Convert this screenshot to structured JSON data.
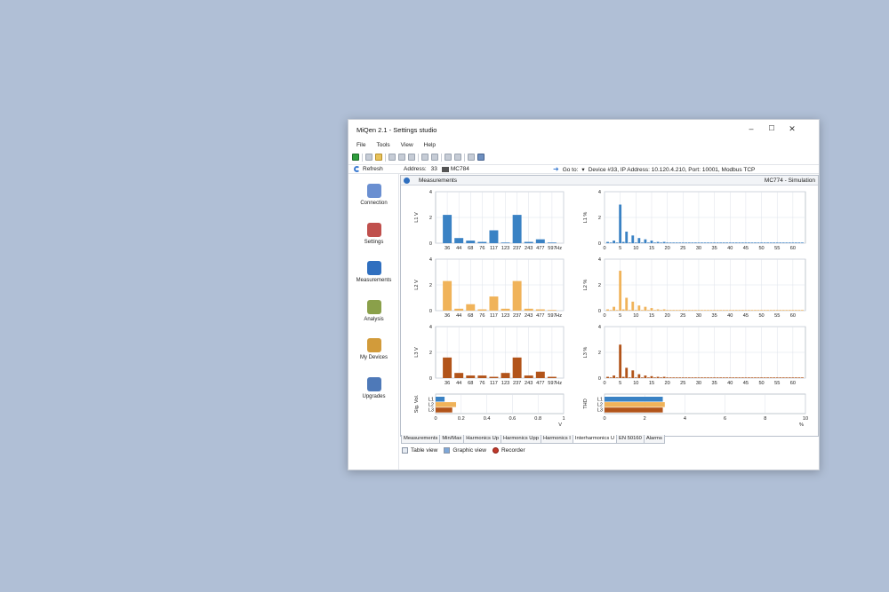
{
  "window": {
    "title": "MiQen 2.1 - Settings studio",
    "minimize": "–",
    "maximize": "☐",
    "close": "✕"
  },
  "menu": [
    "File",
    "Tools",
    "View",
    "Help"
  ],
  "toolbar_icons": [
    "green-export-icon",
    "print-icon",
    "open-folder-icon",
    "save-icon",
    "copy-icon",
    "paste-icon",
    "zoom-icon",
    "document-icon",
    "tag-icon",
    "screen-icon",
    "forward-icon",
    "globe-icon"
  ],
  "address_bar": {
    "refresh_label": "Refresh",
    "address_label": "Address:",
    "address_value": "33",
    "device_model": "MC784",
    "goto_label": "Go to:",
    "goto_caret": "▾",
    "device_info": "Device #33, IP Address: 10.120.4.210, Port: 10001, Modbus TCP"
  },
  "sidebar": [
    {
      "label": "Connection",
      "icon": "connection-icon",
      "color": "#6a8fd1"
    },
    {
      "label": "Settings",
      "icon": "settings-icon",
      "color": "#c0504d"
    },
    {
      "label": "Measurements",
      "icon": "measurements-icon",
      "color": "#2f6fbf"
    },
    {
      "label": "Analysis",
      "icon": "analysis-icon",
      "color": "#8aa04a"
    },
    {
      "label": "My Devices",
      "icon": "my-devices-icon",
      "color": "#d29b3a"
    },
    {
      "label": "Upgrades",
      "icon": "upgrades-icon",
      "color": "#4e79b8"
    }
  ],
  "panel": {
    "title": "Measurements",
    "device_status": "MC774 - Simulation"
  },
  "tabs": [
    "Measurements",
    "Min/Max",
    "Harmonics Up",
    "Harmonics Upp",
    "Harmonics I",
    "Interharmonics U",
    "EN 50160",
    "Alarms"
  ],
  "active_tab": "Interharmonics U",
  "view_buttons": [
    "Table view",
    "Graphic view",
    "Recorder"
  ],
  "colors": {
    "L1": "#3a82c4",
    "L2": "#f0b35a",
    "L3": "#b2541a",
    "grid": "#dde2ea"
  },
  "chart_data": [
    {
      "type": "bar",
      "series_name": "L1",
      "ylabel": "L1   V",
      "xlabel": "Hz",
      "categories": [
        "36",
        "44",
        "68",
        "76",
        "117",
        "123",
        "237",
        "243",
        "477",
        "597"
      ],
      "values": [
        2.2,
        0.4,
        0.2,
        0.1,
        1.0,
        0.05,
        2.2,
        0.1,
        0.3,
        0.05
      ],
      "ylim": [
        0,
        4
      ],
      "yticks": [
        "0",
        "2",
        "4"
      ]
    },
    {
      "type": "bar",
      "series_name": "L2",
      "ylabel": "L2   V",
      "xlabel": "Hz",
      "categories": [
        "36",
        "44",
        "68",
        "76",
        "117",
        "123",
        "237",
        "243",
        "477",
        "597"
      ],
      "values": [
        2.3,
        0.15,
        0.5,
        0.1,
        1.1,
        0.15,
        2.3,
        0.15,
        0.1,
        0.05
      ],
      "ylim": [
        0,
        4
      ],
      "yticks": [
        "0",
        "2",
        "4"
      ]
    },
    {
      "type": "bar",
      "series_name": "L3",
      "ylabel": "L3   V",
      "xlabel": "Hz",
      "categories": [
        "36",
        "44",
        "68",
        "76",
        "117",
        "123",
        "237",
        "243",
        "477",
        "597"
      ],
      "values": [
        1.6,
        0.4,
        0.2,
        0.2,
        0.1,
        0.4,
        1.6,
        0.2,
        0.5,
        0.1
      ],
      "ylim": [
        0,
        4
      ],
      "yticks": [
        "0",
        "2",
        "4"
      ]
    },
    {
      "type": "bar",
      "series_name": "L1",
      "ylabel": "L1   %",
      "xticks": [
        "0",
        "5",
        "10",
        "15",
        "20",
        "25",
        "30",
        "35",
        "40",
        "45",
        "50",
        "55",
        "60"
      ],
      "x": [
        1,
        2,
        3,
        4,
        5,
        6,
        7,
        8,
        9,
        10,
        11,
        12,
        13,
        14,
        15,
        16,
        17,
        18,
        19,
        20,
        21,
        22,
        23,
        24,
        25,
        26,
        27,
        28,
        29,
        30,
        31,
        32,
        33,
        34,
        35,
        36,
        37,
        38,
        39,
        40,
        41,
        42,
        43,
        44,
        45,
        46,
        47,
        48,
        49,
        50,
        51,
        52,
        53,
        54,
        55,
        56,
        57,
        58,
        59,
        60,
        61,
        62,
        63
      ],
      "values": [
        0.1,
        0.05,
        0.2,
        0.05,
        3.0,
        0.1,
        0.9,
        0.05,
        0.6,
        0.05,
        0.4,
        0.05,
        0.3,
        0.05,
        0.2,
        0.05,
        0.1,
        0.05,
        0.1,
        0.05,
        0.05,
        0.05,
        0.05,
        0.05,
        0.05,
        0.05,
        0.05,
        0.05,
        0.05,
        0.05,
        0.05,
        0.05,
        0.05,
        0.05,
        0.05,
        0.05,
        0.05,
        0.05,
        0.05,
        0.05,
        0.05,
        0.05,
        0.05,
        0.05,
        0.05,
        0.05,
        0.05,
        0.05,
        0.05,
        0.05,
        0.05,
        0.05,
        0.05,
        0.05,
        0.05,
        0.05,
        0.05,
        0.05,
        0.05,
        0.05,
        0.05,
        0.05,
        0.05
      ],
      "xlim": [
        0,
        64
      ],
      "ylim": [
        0,
        4
      ],
      "yticks": [
        "0",
        "2",
        "4"
      ]
    },
    {
      "type": "bar",
      "series_name": "L2",
      "ylabel": "L2   %",
      "xticks": [
        "0",
        "5",
        "10",
        "15",
        "20",
        "25",
        "30",
        "35",
        "40",
        "45",
        "50",
        "55",
        "60"
      ],
      "x": [
        1,
        2,
        3,
        4,
        5,
        6,
        7,
        8,
        9,
        10,
        11,
        12,
        13,
        14,
        15,
        16,
        17,
        18,
        19,
        20,
        21,
        22,
        23,
        24,
        25,
        26,
        27,
        28,
        29,
        30,
        31,
        32,
        33,
        34,
        35,
        36,
        37,
        38,
        39,
        40,
        41,
        42,
        43,
        44,
        45,
        46,
        47,
        48,
        49,
        50,
        51,
        52,
        53,
        54,
        55,
        56,
        57,
        58,
        59,
        60,
        61,
        62,
        63
      ],
      "values": [
        0.1,
        0.05,
        0.3,
        0.05,
        3.1,
        0.1,
        1.0,
        0.05,
        0.7,
        0.05,
        0.4,
        0.05,
        0.3,
        0.05,
        0.2,
        0.05,
        0.1,
        0.05,
        0.1,
        0.05,
        0.05,
        0.05,
        0.05,
        0.05,
        0.05,
        0.05,
        0.05,
        0.05,
        0.05,
        0.05,
        0.05,
        0.05,
        0.05,
        0.05,
        0.05,
        0.05,
        0.05,
        0.05,
        0.05,
        0.05,
        0.05,
        0.05,
        0.05,
        0.05,
        0.05,
        0.05,
        0.05,
        0.05,
        0.05,
        0.05,
        0.05,
        0.05,
        0.05,
        0.05,
        0.05,
        0.05,
        0.05,
        0.05,
        0.05,
        0.05,
        0.05,
        0.05,
        0.05
      ],
      "xlim": [
        0,
        64
      ],
      "ylim": [
        0,
        4
      ],
      "yticks": [
        "0",
        "2",
        "4"
      ]
    },
    {
      "type": "bar",
      "series_name": "L3",
      "ylabel": "L3   %",
      "xticks": [
        "0",
        "5",
        "10",
        "15",
        "20",
        "25",
        "30",
        "35",
        "40",
        "45",
        "50",
        "55",
        "60"
      ],
      "x": [
        1,
        2,
        3,
        4,
        5,
        6,
        7,
        8,
        9,
        10,
        11,
        12,
        13,
        14,
        15,
        16,
        17,
        18,
        19,
        20,
        21,
        22,
        23,
        24,
        25,
        26,
        27,
        28,
        29,
        30,
        31,
        32,
        33,
        34,
        35,
        36,
        37,
        38,
        39,
        40,
        41,
        42,
        43,
        44,
        45,
        46,
        47,
        48,
        49,
        50,
        51,
        52,
        53,
        54,
        55,
        56,
        57,
        58,
        59,
        60,
        61,
        62,
        63
      ],
      "values": [
        0.1,
        0.05,
        0.2,
        0.05,
        2.6,
        0.1,
        0.8,
        0.05,
        0.6,
        0.05,
        0.3,
        0.05,
        0.2,
        0.05,
        0.15,
        0.05,
        0.1,
        0.05,
        0.1,
        0.05,
        0.05,
        0.05,
        0.05,
        0.05,
        0.05,
        0.05,
        0.05,
        0.05,
        0.05,
        0.05,
        0.05,
        0.05,
        0.05,
        0.05,
        0.05,
        0.05,
        0.05,
        0.05,
        0.05,
        0.05,
        0.05,
        0.05,
        0.05,
        0.05,
        0.05,
        0.05,
        0.05,
        0.05,
        0.05,
        0.05,
        0.05,
        0.05,
        0.05,
        0.05,
        0.05,
        0.05,
        0.05,
        0.05,
        0.05,
        0.05,
        0.05,
        0.05,
        0.05
      ],
      "xlim": [
        0,
        64
      ],
      "ylim": [
        0,
        4
      ],
      "yticks": [
        "0",
        "2",
        "4"
      ]
    },
    {
      "type": "bar",
      "orientation": "horizontal",
      "ylabel": "Sig. Vol.",
      "xlabel": "V",
      "categories": [
        "L1",
        "L2",
        "L3"
      ],
      "values": [
        0.07,
        0.16,
        0.13
      ],
      "xlim": [
        0,
        1
      ],
      "xticks": [
        "0",
        "0.2",
        "0.4",
        "0.6",
        "0.8",
        "1"
      ]
    },
    {
      "type": "bar",
      "orientation": "horizontal",
      "ylabel": "THD",
      "xlabel": "%",
      "categories": [
        "L1",
        "L2",
        "L3"
      ],
      "values": [
        2.9,
        3.0,
        2.9
      ],
      "xlim": [
        0,
        10
      ],
      "xticks": [
        "0",
        "2",
        "4",
        "6",
        "8",
        "10"
      ]
    }
  ]
}
